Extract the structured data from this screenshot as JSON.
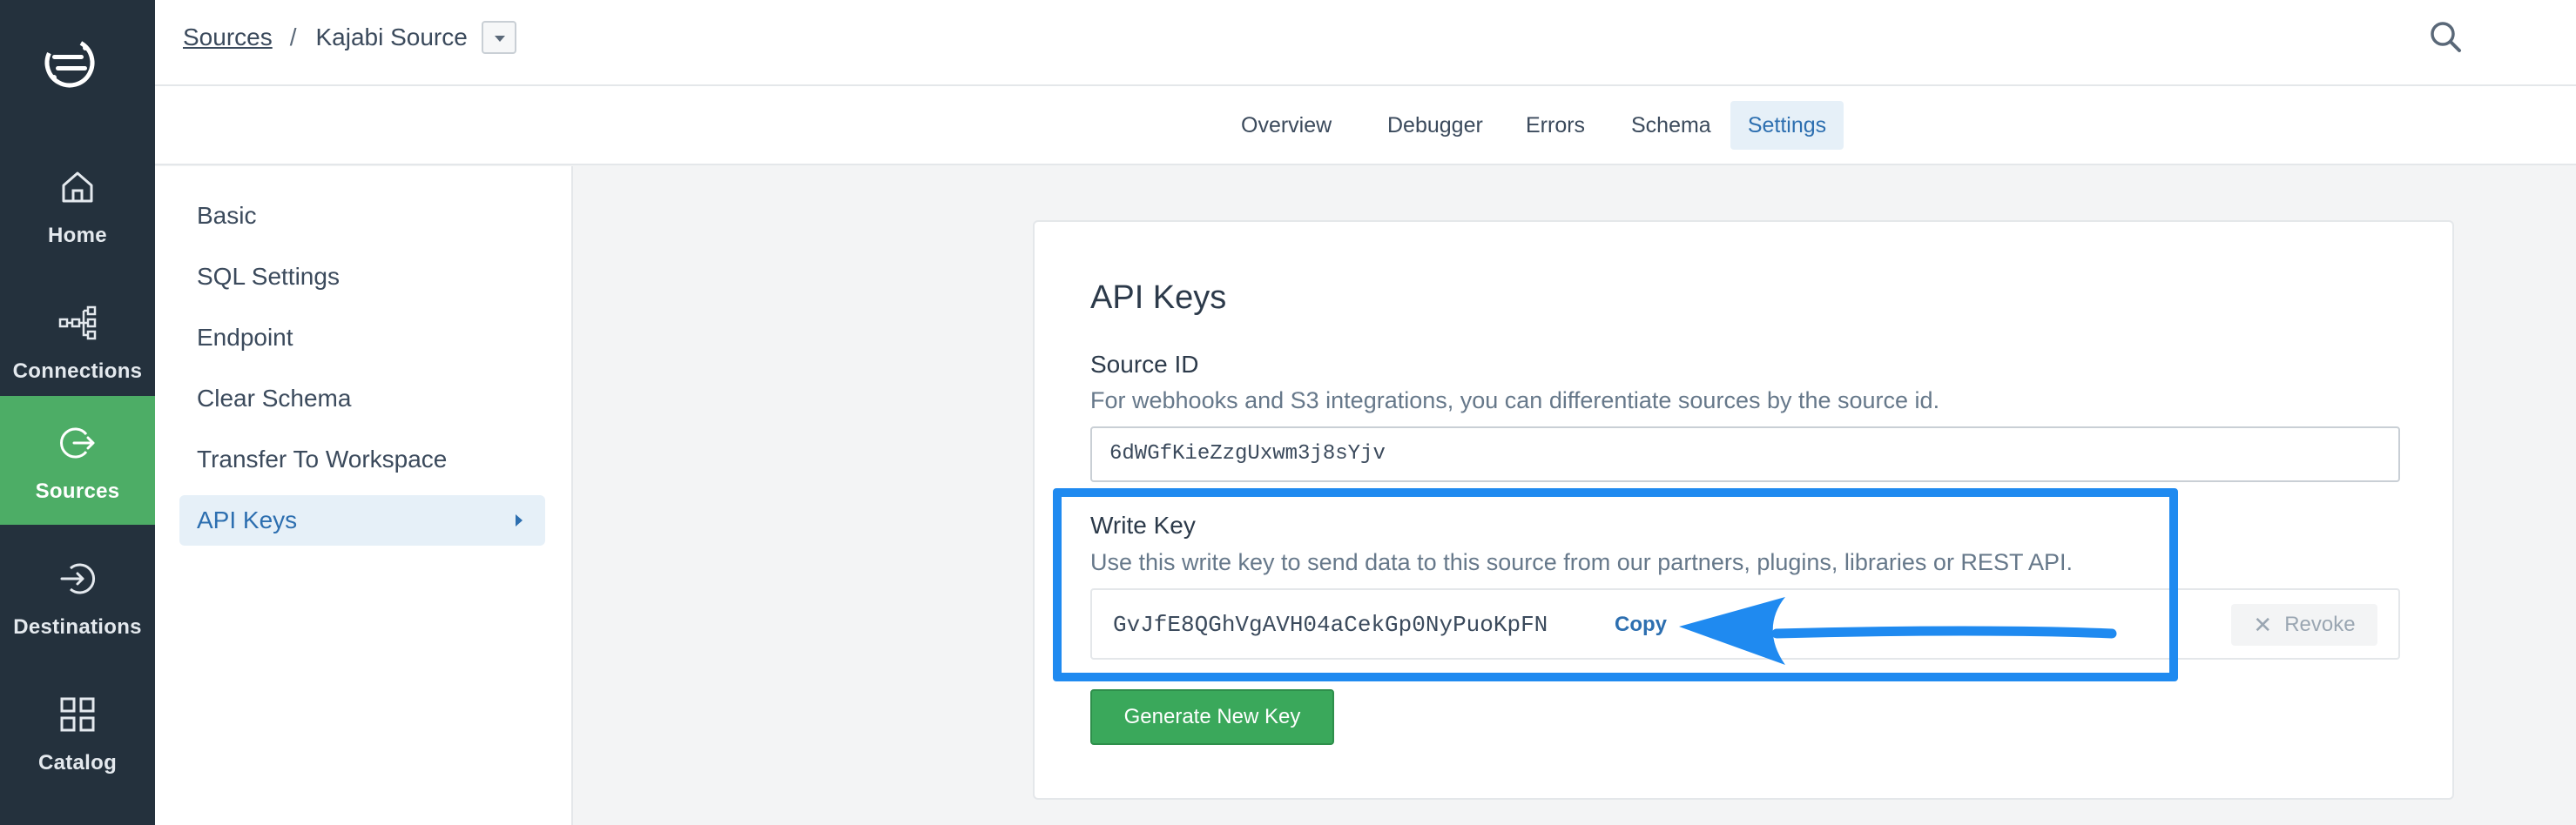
{
  "nav": {
    "items": [
      {
        "label": "Home",
        "icon": "home-icon"
      },
      {
        "label": "Connections",
        "icon": "connections-icon"
      },
      {
        "label": "Sources",
        "icon": "sources-icon",
        "active": true
      },
      {
        "label": "Destinations",
        "icon": "destinations-icon"
      },
      {
        "label": "Catalog",
        "icon": "catalog-icon"
      }
    ],
    "active_color": "#4dad66",
    "bg_color": "#24313d"
  },
  "breadcrumb": {
    "root": "Sources",
    "separator": "/",
    "current": "Kajabi Source"
  },
  "tabs": [
    {
      "label": "Overview"
    },
    {
      "label": "Debugger"
    },
    {
      "label": "Errors"
    },
    {
      "label": "Schema"
    },
    {
      "label": "Settings",
      "active": true
    }
  ],
  "settings_menu": [
    {
      "label": "Basic"
    },
    {
      "label": "SQL Settings"
    },
    {
      "label": "Endpoint"
    },
    {
      "label": "Clear Schema"
    },
    {
      "label": "Transfer To Workspace"
    },
    {
      "label": "API Keys",
      "active": true
    }
  ],
  "card": {
    "title": "API Keys",
    "source_id": {
      "label": "Source ID",
      "description": "For webhooks and S3 integrations, you can differentiate sources by the source id.",
      "value": "6dWGfKieZzgUxwm3j8sYjv"
    },
    "write_key": {
      "label": "Write Key",
      "description": "Use this write key to send data to this source from our partners, plugins, libraries or REST API.",
      "value": "GvJfE8QGhVgAVH04aCekGp0NyPuoKpFN",
      "copy_label": "Copy",
      "revoke_label": "Revoke"
    },
    "generate_label": "Generate New Key"
  },
  "colors": {
    "accent_blue": "#2d6fb0",
    "highlight_blue": "#1f8af0",
    "button_green": "#3aa85b"
  }
}
